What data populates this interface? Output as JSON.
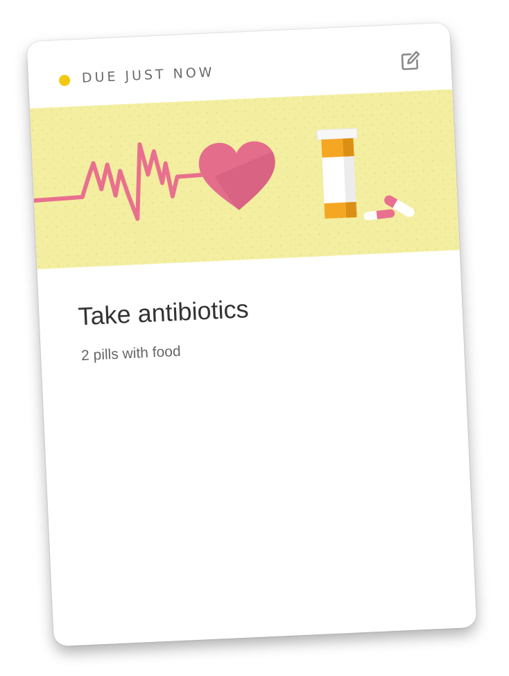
{
  "reminder": {
    "status_label": "DUE JUST NOW",
    "status_color": "#f2c811",
    "edit_icon": "edit-icon",
    "title": "Take antibiotics",
    "subtitle": "2 pills with food"
  },
  "illustration": {
    "background_color": "#f3eea0",
    "heartbeat_color": "#e8708e",
    "heart_color": "#e46d8c",
    "bottle_color": "#f5a623",
    "icons": [
      "heartbeat-line-icon",
      "heart-icon",
      "pill-bottle-icon",
      "capsule-icon"
    ]
  }
}
